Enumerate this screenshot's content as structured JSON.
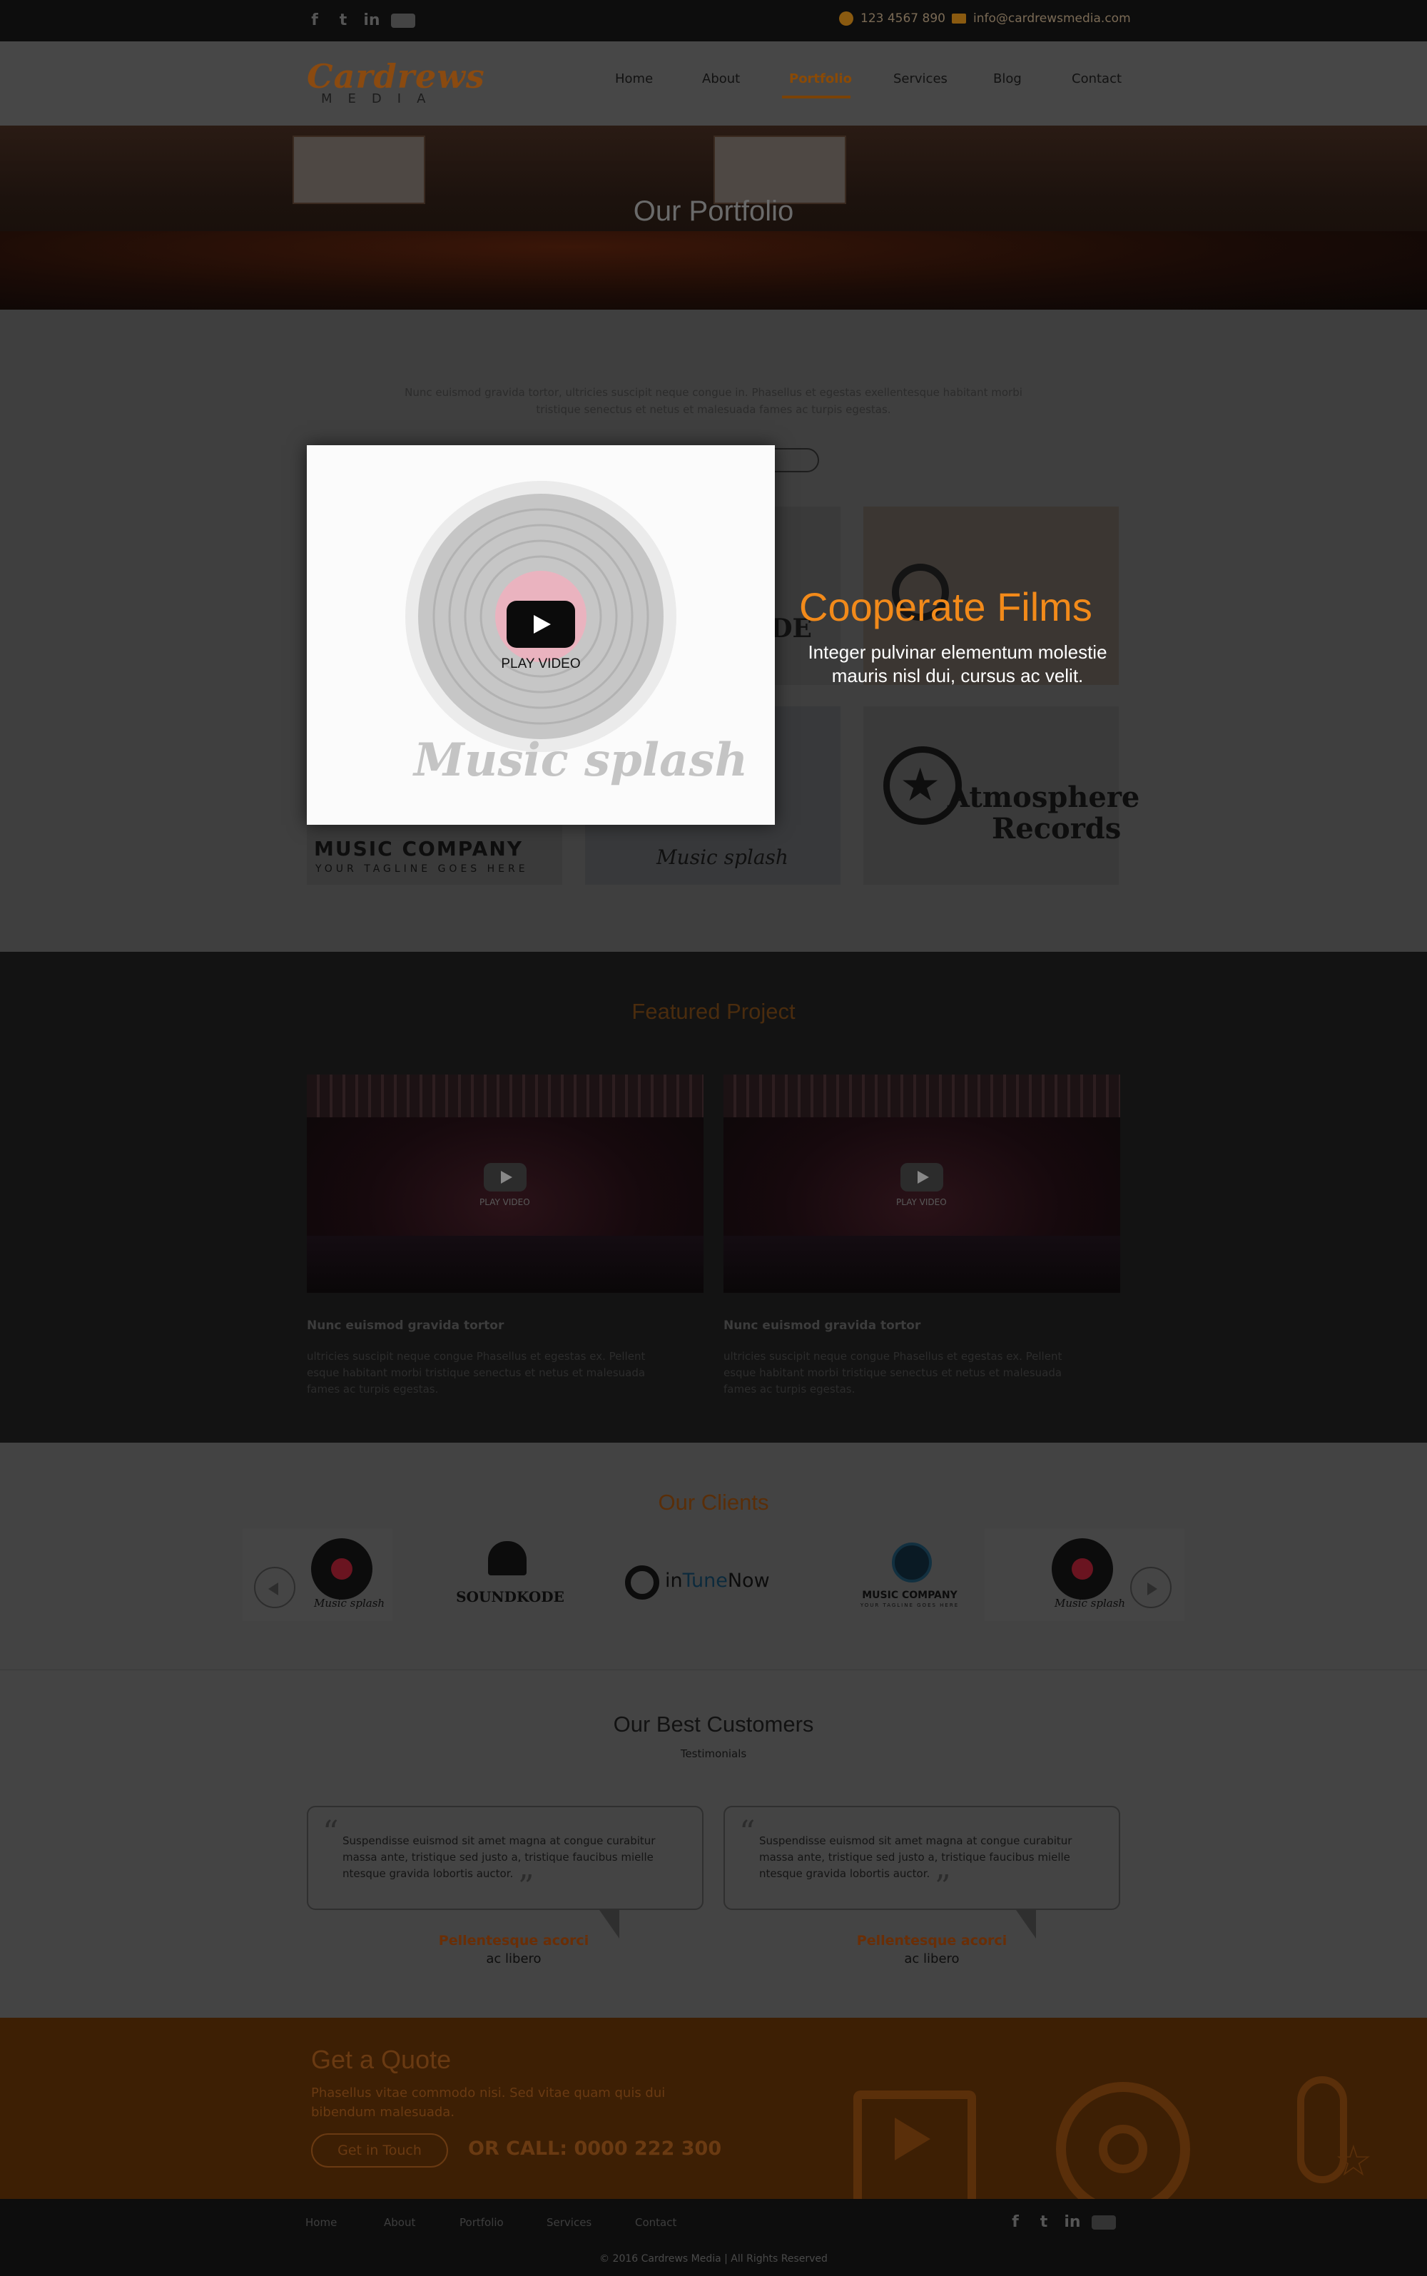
{
  "topbar": {
    "social": [
      "facebook-icon",
      "twitter-icon",
      "linkedin-icon",
      "youtube-icon"
    ],
    "phone": "123 4567 890",
    "email": "info@cardrewsmedia.com"
  },
  "header": {
    "logo_main": "Cardrews",
    "logo_sub": "MEDIA",
    "nav": [
      "Home",
      "About",
      "Portfolio",
      "Services",
      "Blog",
      "Contact"
    ],
    "active_nav": "Portfolio"
  },
  "hero": {
    "title": "Our Portfolio"
  },
  "portfolio": {
    "intro": "Nunc euismod gravida tortor, ultricies suscipit neque congue in. Phasellus et egestas exellentesque habitant morbi tristique senectus et netus et malesuada fames ac turpis egestas.",
    "tiles": [
      {
        "name": "tile-soundkode",
        "text": "DE"
      },
      {
        "name": "tile-cooperate",
        "text": ""
      },
      {
        "name": "tile-music-company",
        "text": "MUSIC COMPANY",
        "sub": "YOUR TAGLINE GOES HERE"
      },
      {
        "name": "tile-music-splash",
        "text": "Music splash"
      },
      {
        "name": "tile-atmosphere",
        "text": "Atmosphere",
        "sub": "Records"
      }
    ],
    "modal": {
      "play_label": "PLAY VIDEO",
      "logo_text": "Music splash"
    },
    "overlay": {
      "title": "Cooperate Films",
      "desc": "Integer pulvinar elementum molestie mauris nisl dui, cursus ac velit."
    }
  },
  "featured": {
    "title": "Featured Project",
    "projects": [
      {
        "play": "PLAY VIDEO",
        "heading": "Nunc euismod gravida tortor",
        "text": "ultricies suscipit neque congue Phasellus et egestas ex. Pellent esque habitant morbi tristique senectus et netus et malesuada fames ac turpis egestas."
      },
      {
        "play": "PLAY VIDEO",
        "heading": "Nunc euismod gravida tortor",
        "text": "ultricies suscipit neque congue Phasellus et egestas ex. Pellent esque habitant morbi tristique senectus et netus et malesuada fames ac turpis egestas."
      }
    ]
  },
  "clients": {
    "title": "Our Clients",
    "logos": [
      "Music splash",
      "SOUNDKODE",
      "inTuneNow",
      "MUSIC COMPANY",
      "Music splash"
    ],
    "intune": {
      "a": "in",
      "b": "Tune",
      "c": "Now"
    },
    "music_company_sub": "YOUR TAGLINE GOES HERE"
  },
  "customers": {
    "title": "Our Best Customers",
    "subtitle": "Testimonials",
    "items": [
      {
        "quote": "Suspendisse euismod sit amet magna at congue curabitur massa ante, tristique sed justo a, tristique faucibus mielle ntesque gravida lobortis auctor.",
        "name": "Pellentesque acorci",
        "sub": "ac libero"
      },
      {
        "quote": "Suspendisse euismod sit amet magna at congue curabitur massa ante, tristique sed justo a, tristique faucibus mielle ntesque gravida lobortis auctor.",
        "name": "Pellentesque acorci",
        "sub": "ac libero"
      }
    ]
  },
  "quote": {
    "title": "Get a Quote",
    "text": "Phasellus vitae commodo nisi. Sed vitae quam quis dui bibendum malesuada.",
    "button": "Get in Touch",
    "call": "OR  CALL: 0000 222 300"
  },
  "footer": {
    "nav": [
      "Home",
      "About",
      "Portfolio",
      "Services",
      "Contact"
    ],
    "copyright": "© 2016 Cardrews Media   |   All Rights Reserved"
  },
  "colors": {
    "accent": "#f28a1a",
    "dark": "#0d0d0d",
    "overlay": "rgba(0,0,0,0.72)"
  }
}
